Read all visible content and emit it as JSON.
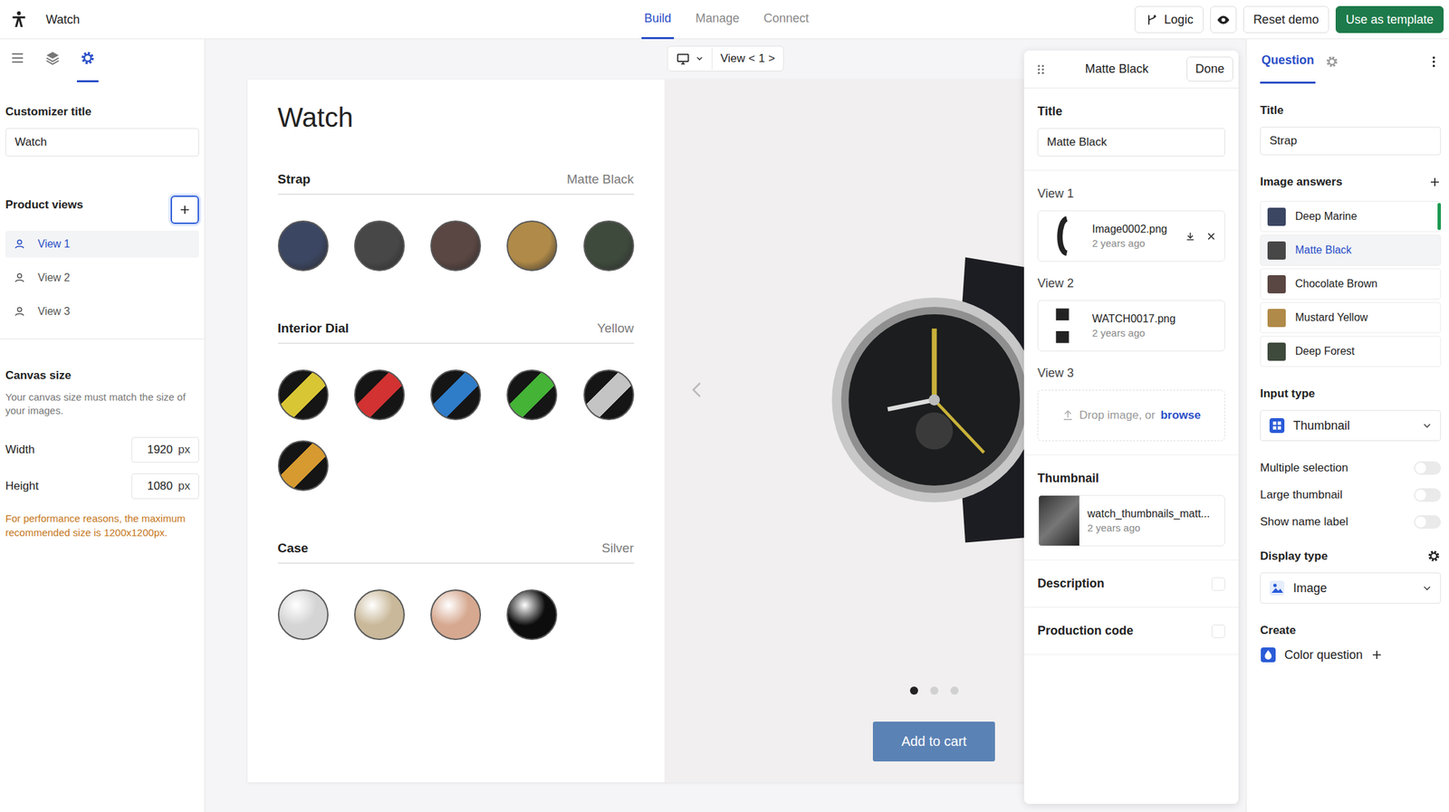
{
  "app": {
    "title": "Watch"
  },
  "nav_tabs": [
    {
      "label": "Build",
      "selected": true
    },
    {
      "label": "Manage",
      "selected": false
    },
    {
      "label": "Connect",
      "selected": false
    }
  ],
  "header_buttons": {
    "logic": "Logic",
    "reset": "Reset demo",
    "template": "Use as template"
  },
  "left_panel": {
    "tabs": [
      {
        "kind": "menu",
        "selected": false
      },
      {
        "kind": "layers",
        "selected": false
      },
      {
        "kind": "settings",
        "selected": true
      }
    ],
    "customizer_title": {
      "label": "Customizer title",
      "value": "Watch"
    },
    "product_views": {
      "label": "Product views",
      "views": [
        {
          "label": "View 1",
          "selected": true
        },
        {
          "label": "View 2",
          "selected": false
        },
        {
          "label": "View 3",
          "selected": false
        }
      ]
    },
    "canvas": {
      "label": "Canvas size",
      "hint": "Your canvas size must match the size of your images.",
      "width_label": "Width",
      "width": "1920",
      "height_label": "Height",
      "height": "1080",
      "unit": "px",
      "warning": "For performance reasons, the maximum recommended size is 1200x1200px."
    }
  },
  "view_selector": {
    "label": "View",
    "prev": "<",
    "current": "1",
    "next": ">"
  },
  "preview": {
    "title": "Watch",
    "questions": [
      {
        "name": "Strap",
        "value": "Matte Black",
        "kind": "strap",
        "options": [
          {
            "color": "#3b4662"
          },
          {
            "color": "#474747"
          },
          {
            "color": "#5a4642"
          },
          {
            "color": "#b08a48"
          },
          {
            "color": "#3e4a3c"
          }
        ]
      },
      {
        "name": "Interior Dial",
        "value": "Yellow",
        "kind": "dial",
        "options": [
          {
            "color": "#d9c634"
          },
          {
            "color": "#d23232"
          },
          {
            "color": "#2f7cc9"
          },
          {
            "color": "#45b336"
          },
          {
            "color": "#c4c4c4"
          },
          {
            "color": "#d69a30"
          }
        ]
      },
      {
        "name": "Case",
        "value": "Silver",
        "kind": "case",
        "options": [
          {
            "color": "#d4d4d4"
          },
          {
            "color": "#c9b899"
          },
          {
            "color": "#d6a88f"
          },
          {
            "color": "#0d0d0d"
          }
        ]
      }
    ],
    "dots": [
      {
        "selected": true
      },
      {
        "selected": false
      },
      {
        "selected": false
      }
    ],
    "add_to_cart": "Add to cart"
  },
  "answer_editor": {
    "title": "Matte Black",
    "done": "Done",
    "title_label": "Title",
    "title_value": "Matte Black",
    "views": [
      {
        "label": "View 1",
        "kind": "file",
        "file": "Image0002.png",
        "age": "2 years ago",
        "actions_visible": true
      },
      {
        "label": "View 2",
        "kind": "file",
        "file": "WATCH0017.png",
        "age": "2 years ago",
        "actions_visible": false
      },
      {
        "label": "View 3",
        "kind": "empty",
        "drop": "Drop image, or",
        "browse": "browse"
      }
    ],
    "thumbnail": {
      "label": "Thumbnail",
      "file": "watch_thumbnails_matt...",
      "age": "2 years ago"
    },
    "options": [
      {
        "label": "Description",
        "checked": false
      },
      {
        "label": "Production code",
        "checked": false
      }
    ]
  },
  "question_panel": {
    "tabs": [
      {
        "label": "Question",
        "selected": true
      }
    ],
    "title_label": "Title",
    "title_value": "Strap",
    "answers_label": "Image answers",
    "answers": [
      {
        "name": "Deep Marine",
        "color": "#3b4662",
        "selected": false,
        "marked": true
      },
      {
        "name": "Matte Black",
        "color": "#474747",
        "selected": true,
        "marked": false
      },
      {
        "name": "Chocolate Brown",
        "color": "#5a4642",
        "selected": false,
        "marked": false
      },
      {
        "name": "Mustard Yellow",
        "color": "#b08a48",
        "selected": false,
        "marked": false
      },
      {
        "name": "Deep Forest",
        "color": "#3e4a3c",
        "selected": false,
        "marked": false
      }
    ],
    "input_type_label": "Input type",
    "input_type": "Thumbnail",
    "toggles": [
      {
        "label": "Multiple selection",
        "on": false
      },
      {
        "label": "Large thumbnail",
        "on": false
      },
      {
        "label": "Show name label",
        "on": false
      }
    ],
    "display_type_label": "Display type",
    "display_type": "Image",
    "create_label": "Create",
    "create_item": "Color question"
  }
}
